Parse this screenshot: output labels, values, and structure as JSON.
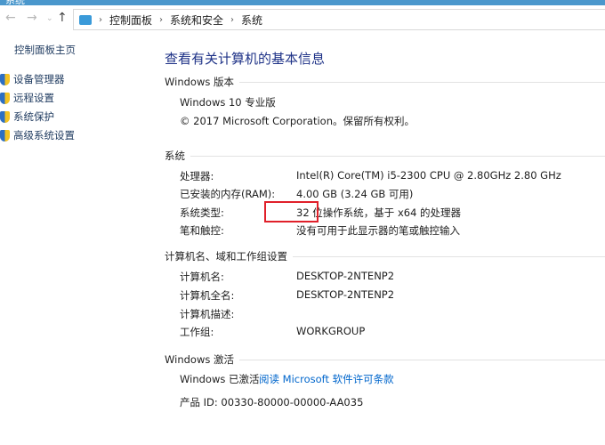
{
  "window": {
    "title": "系统"
  },
  "breadcrumb": [
    "控制面板",
    "系统和安全",
    "系统"
  ],
  "sidebar": {
    "home": "控制面板主页",
    "items": [
      {
        "label": "设备管理器",
        "icon": "shield-icon"
      },
      {
        "label": "远程设置",
        "icon": "shield-icon"
      },
      {
        "label": "系统保护",
        "icon": "shield-icon"
      },
      {
        "label": "高级系统设置",
        "icon": "shield-icon"
      }
    ]
  },
  "main": {
    "title": "查看有关计算机的基本信息",
    "edition": {
      "header": "Windows 版本",
      "name": "Windows 10 专业版",
      "copyright": "© 2017 Microsoft Corporation。保留所有权利。"
    },
    "system": {
      "header": "系统",
      "rows": [
        {
          "label": "处理器:",
          "value": "Intel(R) Core(TM) i5-2300 CPU @ 2.80GHz   2.80 GHz"
        },
        {
          "label": "已安装的内存(RAM):",
          "value": "4.00 GB (3.24 GB 可用)"
        },
        {
          "label": "系统类型:",
          "value": "32 位操作系统，基于 x64 的处理器"
        },
        {
          "label": "笔和触控:",
          "value": "没有可用于此显示器的笔或触控输入"
        }
      ]
    },
    "computer": {
      "header": "计算机名、域和工作组设置",
      "rows": [
        {
          "label": "计算机名:",
          "value": "DESKTOP-2NTENP2"
        },
        {
          "label": "计算机全名:",
          "value": "DESKTOP-2NTENP2"
        },
        {
          "label": "计算机描述:",
          "value": ""
        },
        {
          "label": "工作组:",
          "value": "WORKGROUP"
        }
      ]
    },
    "activation": {
      "header": "Windows 激活",
      "status": "Windows 已激活",
      "link": "阅读 Microsoft 软件许可条款",
      "product_id": "产品 ID: 00330-80000-00000-AA035"
    }
  },
  "colors": {
    "highlight_box": "#e0202a",
    "title": "#1e3287",
    "link": "#0066cc"
  }
}
